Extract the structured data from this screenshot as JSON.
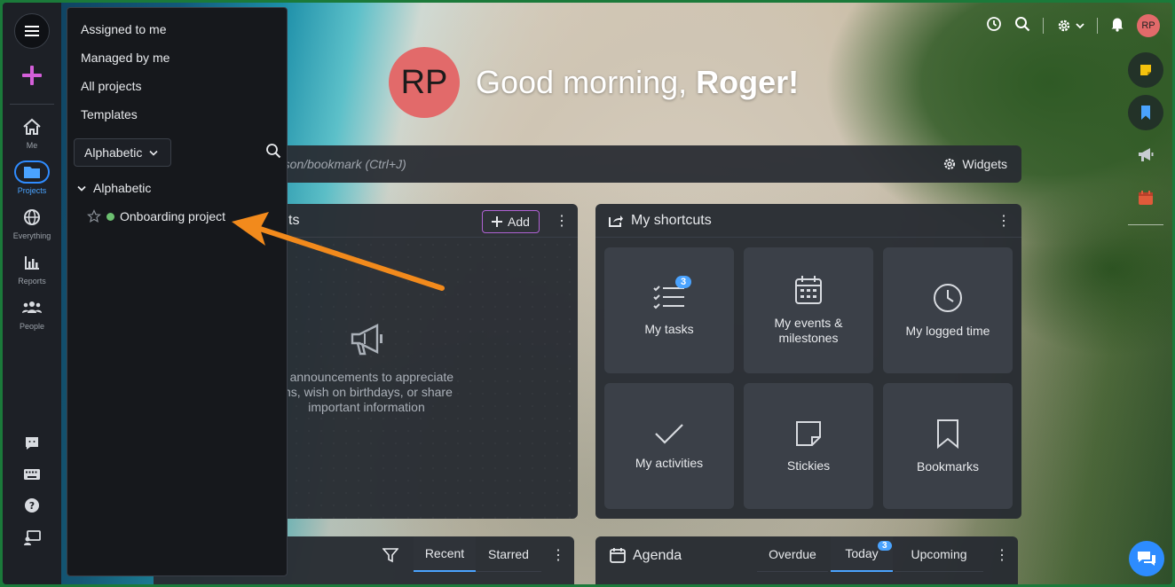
{
  "left_nav": {
    "items": [
      {
        "key": "me",
        "label": "Me"
      },
      {
        "key": "projects",
        "label": "Projects"
      },
      {
        "key": "everything",
        "label": "Everything"
      },
      {
        "key": "reports",
        "label": "Reports"
      },
      {
        "key": "people",
        "label": "People"
      }
    ],
    "active": "projects"
  },
  "projects_menu": {
    "items": [
      "Assigned to me",
      "Managed by me",
      "All projects",
      "Templates"
    ],
    "sort_value": "Alphabetic",
    "group_label": "Alphabetic",
    "project": {
      "name": "Onboarding project",
      "status_color": "#6cc070"
    }
  },
  "header": {
    "greeting_prefix": "Good morning, ",
    "user_name": "Roger!",
    "avatar_initials": "RP"
  },
  "search": {
    "placeholder_visible": "rson/bookmark (Ctrl+J)",
    "widgets_label": "Widgets"
  },
  "announcements": {
    "title_visible": "ts",
    "add_label": "Add",
    "empty_line1": "e announcements to appreciate",
    "empty_line2": "ms, wish on birthdays, or share",
    "empty_line3": "important information"
  },
  "shortcuts": {
    "title": "My shortcuts",
    "tiles": [
      {
        "label": "My tasks",
        "badge": "3",
        "icon": "checklist-icon"
      },
      {
        "label": "My events & milestones",
        "icon": "calendar-icon"
      },
      {
        "label": "My logged time",
        "icon": "clock-icon"
      },
      {
        "label": "My activities",
        "icon": "check-icon"
      },
      {
        "label": "Stickies",
        "icon": "sticky-note-icon"
      },
      {
        "label": "Bookmarks",
        "icon": "bookmark-icon"
      }
    ]
  },
  "feed": {
    "tabs": [
      "Recent",
      "Starred"
    ],
    "selected": "Recent"
  },
  "agenda": {
    "title": "Agenda",
    "tabs": [
      "Overdue",
      "Today",
      "Upcoming"
    ],
    "selected": "Today",
    "today_badge": "3"
  },
  "colors": {
    "accent": "#4aa3ff",
    "avatar": "#e26a6a",
    "arrow": "#f28a1c",
    "add_border": "#b062d4"
  }
}
